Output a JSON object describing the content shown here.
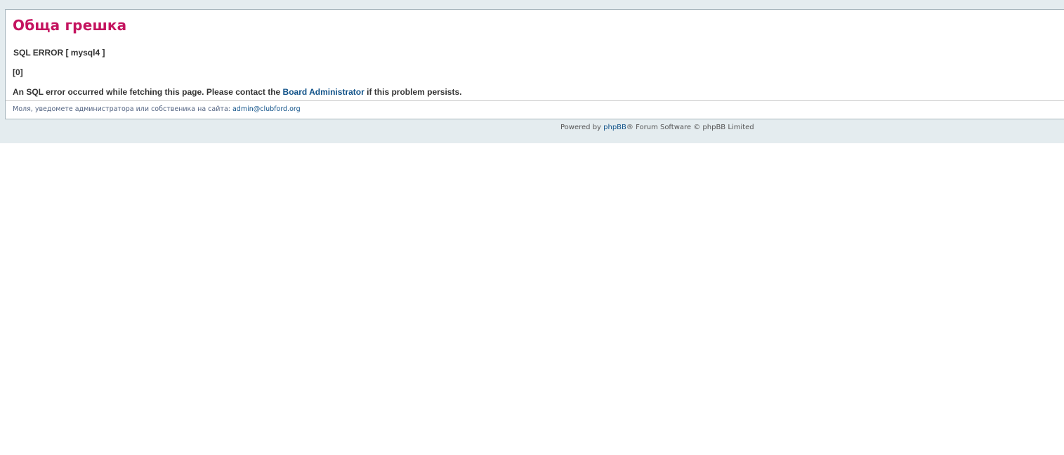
{
  "error": {
    "title": "Обща грешка",
    "sql_error": "SQL ERROR [ mysql4 ]",
    "code": "[0]",
    "message_before": "An SQL error occurred while fetching this page. Please contact the ",
    "admin_link": "Board Administrator",
    "message_after": " if this problem persists."
  },
  "notice": {
    "text": "Моля, уведомете администратора или собственика на сайта: ",
    "email": "admin@clubford.org"
  },
  "footer": {
    "prefix": "Powered by ",
    "phpbb_link": "phpBB",
    "suffix": "® Forum Software © phpBB Limited"
  },
  "colors": {
    "title": "#c4135f",
    "link": "#105289",
    "background": "#e4ecef"
  }
}
